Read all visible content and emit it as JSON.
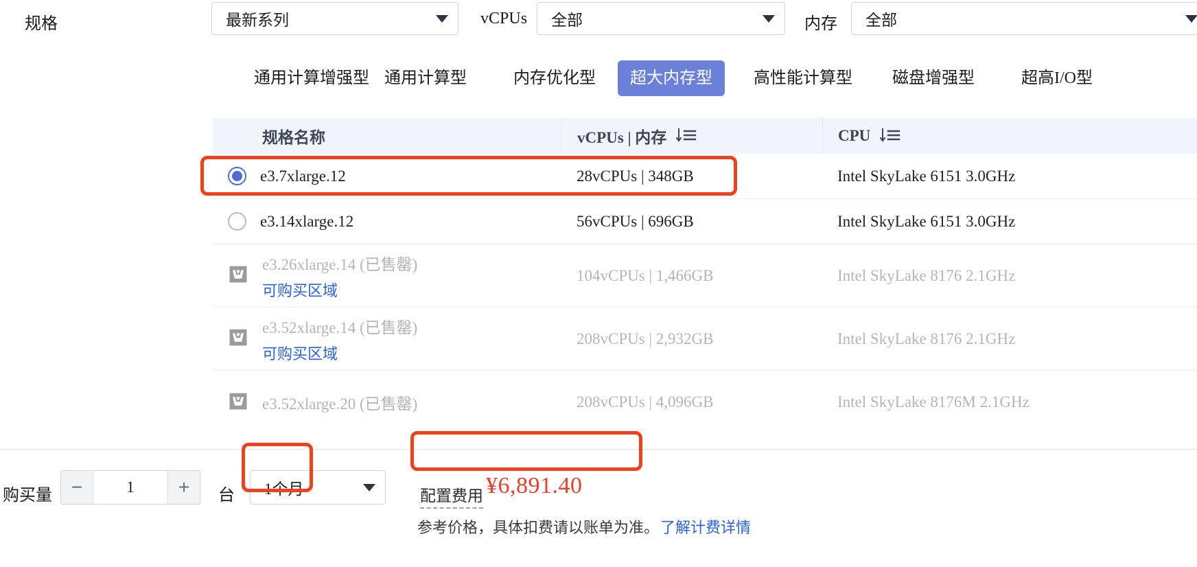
{
  "filters": [
    {
      "label": "规格",
      "value": "最新系列",
      "name": "series"
    },
    {
      "label": "vCPUs",
      "value": "全部",
      "name": "vcpus"
    },
    {
      "label": "内存",
      "value": "全部",
      "name": "memory"
    }
  ],
  "tabs": [
    {
      "label": "通用计算增强型",
      "active": false
    },
    {
      "label": "通用计算型",
      "active": false
    },
    {
      "label": "内存优化型",
      "active": false
    },
    {
      "label": "超大内存型",
      "active": true
    },
    {
      "label": "高性能计算型",
      "active": false
    },
    {
      "label": "磁盘增强型",
      "active": false
    },
    {
      "label": "超高I/O型",
      "active": false
    }
  ],
  "table": {
    "headers": {
      "name": "规格名称",
      "vcpu_mem": "vCPUs | 内存",
      "cpu": "CPU"
    },
    "sort_icon": "sort-descending-icon",
    "rows": [
      {
        "name": "e3.7xlarge.12",
        "vcpu_mem": "28vCPUs | 348GB",
        "cpu": "Intel SkyLake 6151 3.0GHz",
        "selected": true,
        "sold_out": false,
        "region_link": ""
      },
      {
        "name": "e3.14xlarge.12",
        "vcpu_mem": "56vCPUs | 696GB",
        "cpu": "Intel SkyLake 6151 3.0GHz",
        "selected": false,
        "sold_out": false,
        "region_link": ""
      },
      {
        "name": "e3.26xlarge.14 (已售罄)",
        "vcpu_mem": "104vCPUs | 1,466GB",
        "cpu": "Intel SkyLake 8176 2.1GHz",
        "selected": false,
        "sold_out": true,
        "region_link": "可购买区域"
      },
      {
        "name": "e3.52xlarge.14 (已售罄)",
        "vcpu_mem": "208vCPUs | 2,932GB",
        "cpu": "Intel SkyLake 8176 2.1GHz",
        "selected": false,
        "sold_out": true,
        "region_link": "可购买区域"
      },
      {
        "name": "e3.52xlarge.20 (已售罄)",
        "vcpu_mem": "208vCPUs | 4,096GB",
        "cpu": "Intel SkyLake 8176M 2.1GHz",
        "selected": false,
        "sold_out": true,
        "region_link": ""
      }
    ]
  },
  "bottom": {
    "quantity_label": "购买量",
    "quantity_value": "1",
    "decrement": "−",
    "increment": "+",
    "unit": "台",
    "duration_value": "1个月",
    "price_label": "配置费用",
    "price_value": "¥6,891.40",
    "price_note": "参考价格，具体扣费请以账单为准。",
    "price_note_link": "了解计费详情"
  },
  "colors": {
    "accent_blue": "#6b80d8",
    "link_blue": "#2b62d9",
    "radio_blue": "#4c6cd4",
    "price_red": "#e8402a",
    "annotation_red": "#f0411f",
    "header_bg": "#f2f4fb",
    "muted_text": "#b5b5b8"
  }
}
